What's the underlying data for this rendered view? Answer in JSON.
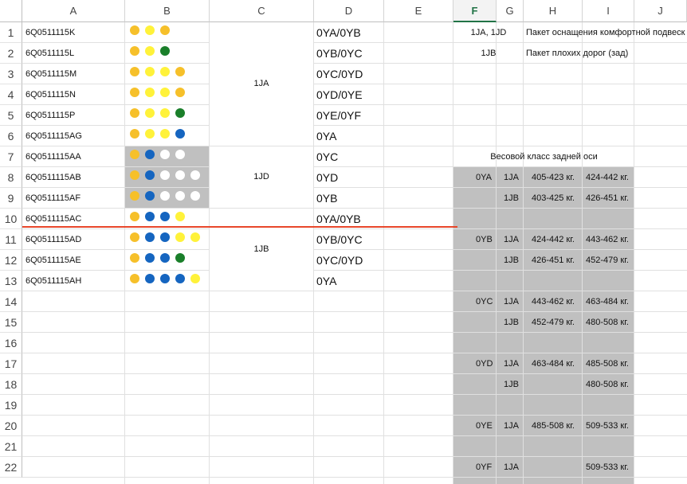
{
  "colors": {
    "yellow": "#fff23a",
    "orange": "#f6c02a",
    "green": "#1a7f2a",
    "blue": "#1565c0",
    "white": "#ffffff",
    "gray": "#c0c0c0",
    "red_line": "#e8472b",
    "selected_header": "#217346"
  },
  "columns": [
    "A",
    "B",
    "C",
    "D",
    "E",
    "F",
    "G",
    "H",
    "I",
    "J"
  ],
  "selected_column": "F",
  "rows": [
    "1",
    "2",
    "3",
    "4",
    "5",
    "6",
    "7",
    "8",
    "9",
    "10",
    "11",
    "12",
    "13",
    "14",
    "15",
    "16",
    "17",
    "18",
    "19",
    "20",
    "21",
    "22"
  ],
  "parts": [
    {
      "code": "6Q0511115K",
      "dots": [
        "orange",
        "yellow",
        "orange"
      ],
      "d": "0YA/0YB"
    },
    {
      "code": "6Q0511115L",
      "dots": [
        "orange",
        "yellow",
        "green"
      ],
      "d": "0YB/0YC"
    },
    {
      "code": "6Q0511115M",
      "dots": [
        "orange",
        "yellow",
        "yellow",
        "orange"
      ],
      "d": "0YC/0YD"
    },
    {
      "code": "6Q0511115N",
      "dots": [
        "orange",
        "yellow",
        "yellow",
        "orange"
      ],
      "d": "0YD/0YE"
    },
    {
      "code": "6Q0511115P",
      "dots": [
        "orange",
        "yellow",
        "yellow",
        "green"
      ],
      "d": "0YE/0YF"
    },
    {
      "code": "6Q0511115AG",
      "dots": [
        "orange",
        "yellow",
        "yellow",
        "blue"
      ],
      "d": "0YA"
    },
    {
      "code": "6Q0511115AA",
      "dots": [
        "orange",
        "blue",
        "white",
        "white"
      ],
      "d": "0YC"
    },
    {
      "code": "6Q0511115AB",
      "dots": [
        "orange",
        "blue",
        "white",
        "white",
        "white"
      ],
      "d": "0YD"
    },
    {
      "code": "6Q0511115AF",
      "dots": [
        "orange",
        "blue",
        "white",
        "white",
        "white"
      ],
      "d": "0YB"
    },
    {
      "code": "6Q0511115AC",
      "dots": [
        "orange",
        "blue",
        "blue",
        "yellow"
      ],
      "d": "0YA/0YB"
    },
    {
      "code": "6Q0511115AD",
      "dots": [
        "orange",
        "blue",
        "blue",
        "yellow",
        "yellow"
      ],
      "d": "0YB/0YC"
    },
    {
      "code": "6Q0511115AE",
      "dots": [
        "orange",
        "blue",
        "blue",
        "green"
      ],
      "d": "0YC/0YD"
    },
    {
      "code": "6Q0511115AH",
      "dots": [
        "orange",
        "blue",
        "blue",
        "blue",
        "yellow"
      ],
      "d": "0YA"
    }
  ],
  "c_groups": {
    "g1": "1JA",
    "g2": "1JD",
    "g3": "1JB"
  },
  "packages": [
    {
      "codes": "1JA, 1JD",
      "name": "Пакет оснащения комфортной подвеск"
    },
    {
      "codes": "1JB",
      "name": "Пакет плохих дорог (зад)"
    }
  ],
  "weight_title": "Весовой класс задней оси",
  "weight": [
    {
      "cls": "0YA",
      "eq": "1JA",
      "h": "405-423 кг.",
      "i": "424-442 кг."
    },
    {
      "cls": "",
      "eq": "1JB",
      "h": "403-425 кг.",
      "i": "426-451 кг."
    },
    {
      "cls": "0YB",
      "eq": "1JA",
      "h": "424-442 кг.",
      "i": "443-462 кг."
    },
    {
      "cls": "",
      "eq": "1JB",
      "h": "426-451 кг.",
      "i": "452-479 кг."
    },
    {
      "cls": "0YC",
      "eq": "1JA",
      "h": "443-462 кг.",
      "i": "463-484 кг."
    },
    {
      "cls": "",
      "eq": "1JB",
      "h": "452-479 кг.",
      "i": "480-508 кг."
    },
    {
      "cls": "0YD",
      "eq": "1JA",
      "h": "463-484 кг.",
      "i": "485-508 кг."
    },
    {
      "cls": "",
      "eq": "1JB",
      "h": "",
      "i": "480-508 кг."
    },
    {
      "cls": "0YE",
      "eq": "1JA",
      "h": "485-508 кг.",
      "i": "509-533 кг."
    },
    {
      "cls": "0YF",
      "eq": "1JA",
      "h": "",
      "i": "509-533 кг."
    }
  ]
}
